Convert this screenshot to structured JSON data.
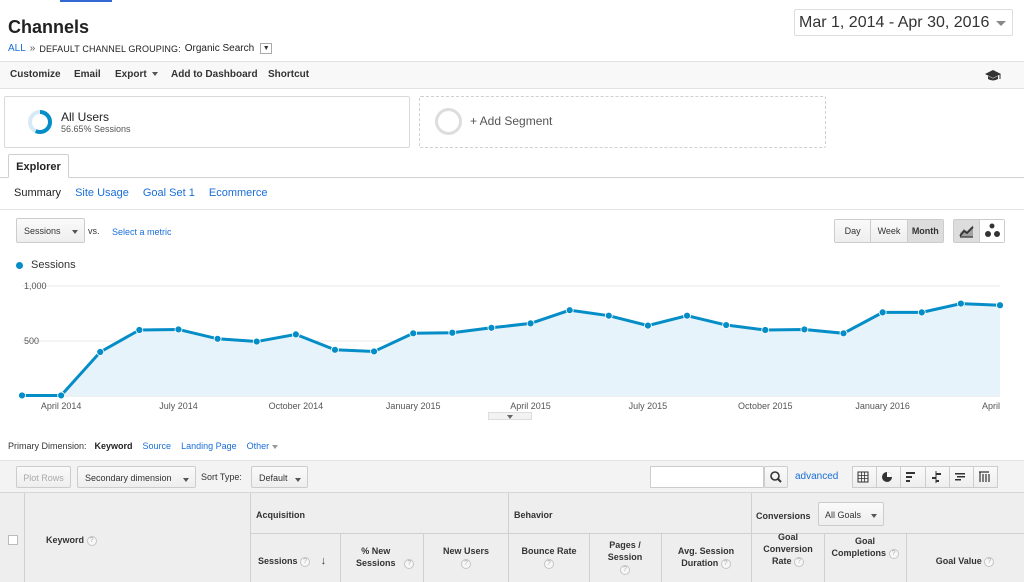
{
  "page": {
    "title": "Channels",
    "date_range": "Mar 1, 2014 - Apr 30, 2016"
  },
  "breadcrumb": {
    "root": "ALL",
    "separator": "»",
    "grouping_label": "DEFAULT CHANNEL GROUPING:",
    "grouping_value": "Organic Search"
  },
  "toolbar": {
    "customize": "Customize",
    "email": "Email",
    "export": "Export",
    "add_to_dashboard": "Add to Dashboard",
    "shortcut": "Shortcut",
    "help_icon": "graduation-cap-icon"
  },
  "segments": {
    "active_name": "All Users",
    "active_share": "56.65% Sessions",
    "share_fraction": 0.5665,
    "add_label": "+ Add Segment"
  },
  "explorer": {
    "tab": "Explorer",
    "subtabs": [
      "Summary",
      "Site Usage",
      "Goal Set 1",
      "Ecommerce"
    ]
  },
  "chart_controls": {
    "metric": "Sessions",
    "vs": "vs.",
    "select_metric": "Select a metric",
    "periods": [
      "Day",
      "Week",
      "Month"
    ],
    "active_period": "Month"
  },
  "chart_data": {
    "type": "area",
    "series": [
      {
        "name": "Sessions",
        "values": [
          5,
          5,
          400,
          600,
          605,
          520,
          495,
          560,
          420,
          405,
          570,
          575,
          620,
          660,
          780,
          730,
          640,
          730,
          645,
          600,
          605,
          570,
          760,
          760,
          840,
          825
        ]
      }
    ],
    "x": [
      "2014-03",
      "2014-04",
      "2014-05",
      "2014-06",
      "2014-07",
      "2014-08",
      "2014-09",
      "2014-10",
      "2014-11",
      "2014-12",
      "2015-01",
      "2015-02",
      "2015-03",
      "2015-04",
      "2015-05",
      "2015-06",
      "2015-07",
      "2015-08",
      "2015-09",
      "2015-10",
      "2015-11",
      "2015-12",
      "2016-01",
      "2016-02",
      "2016-03",
      "2016-04"
    ],
    "x_tick_labels": [
      "April 2014",
      "July 2014",
      "October 2014",
      "January 2015",
      "April 2015",
      "July 2015",
      "October 2015",
      "January 2016",
      "April"
    ],
    "y_tick_labels": [
      "1,000",
      "500"
    ],
    "ylim": [
      0,
      1000
    ],
    "color": "#058dc7",
    "fill": "#e6f3fa",
    "grid": true,
    "legend": "top-left"
  },
  "dimensions": {
    "label": "Primary Dimension:",
    "active": "Keyword",
    "options": [
      "Source",
      "Landing Page",
      "Other"
    ]
  },
  "table_controls": {
    "plot_rows": "Plot Rows",
    "secondary_dimension": "Secondary dimension",
    "sort_type_label": "Sort Type:",
    "sort_type": "Default",
    "advanced": "advanced"
  },
  "table": {
    "keyword_header": "Keyword",
    "groups": {
      "acquisition": "Acquisition",
      "behavior": "Behavior",
      "conversions": "Conversions",
      "goals_select": "All Goals"
    },
    "columns": {
      "sessions": "Sessions",
      "pct_new_sessions": "% New Sessions",
      "new_users": "New Users",
      "bounce_rate": "Bounce Rate",
      "pages_session": "Pages / Session",
      "avg_session_duration": "Avg. Session Duration",
      "goal_conversion_rate": "Goal Conversion Rate",
      "goal_completions": "Goal Completions",
      "goal_value": "Goal Value"
    }
  }
}
